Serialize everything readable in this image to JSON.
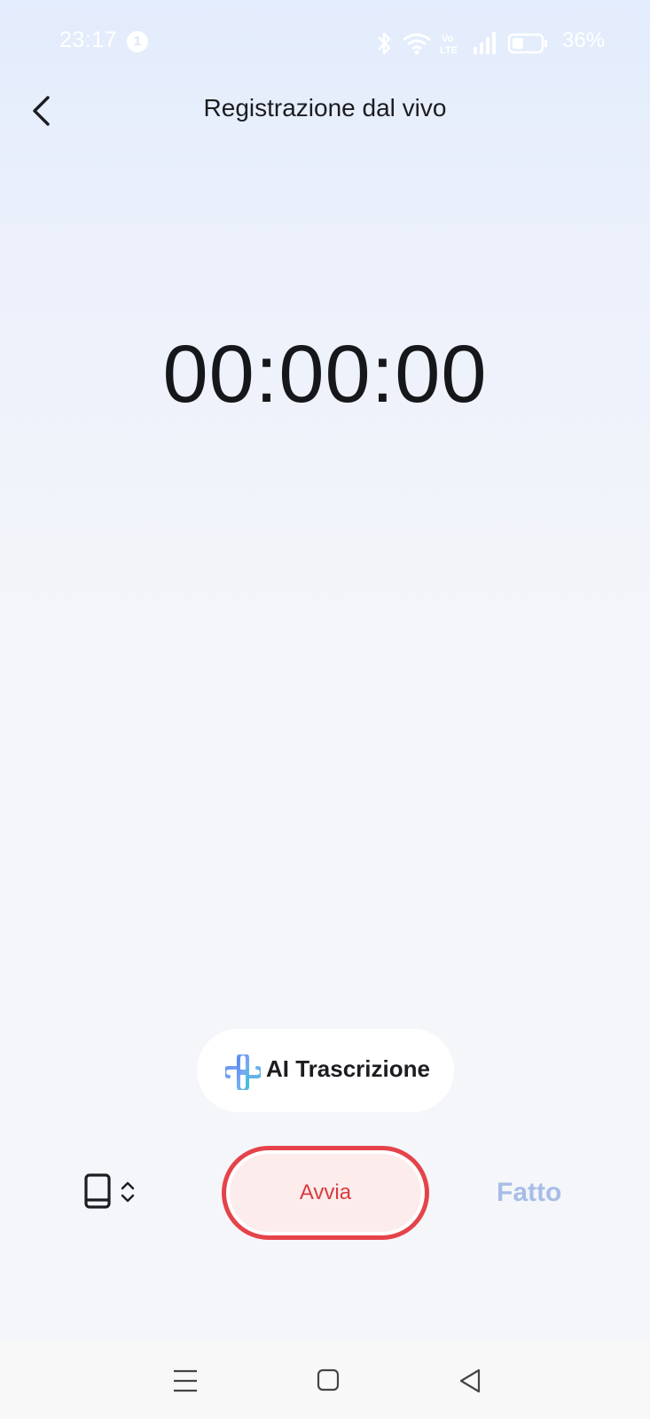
{
  "status_bar": {
    "time": "23:17",
    "notification_count": "1",
    "battery_percent": "36%",
    "icons": [
      "bluetooth-icon",
      "wifi-icon",
      "volte-icon",
      "signal-icon",
      "battery-icon"
    ]
  },
  "header": {
    "title": "Registrazione dal vivo",
    "back_icon": "chevron-left-icon"
  },
  "timer": {
    "value": "00:00:00"
  },
  "ai_transcription": {
    "label": "AI Trascrizione",
    "icon": "ai-knot-icon"
  },
  "controls": {
    "device_icon": "tablet-icon",
    "start_label": "Avvia",
    "done_label": "Fatto"
  },
  "nav_bar": {
    "icons": [
      "menu-icon",
      "home-icon",
      "back-triangle-icon"
    ]
  },
  "colors": {
    "accent_red": "#e5434a",
    "done_disabled": "#a7bde6",
    "text_primary": "#1c1d21"
  }
}
